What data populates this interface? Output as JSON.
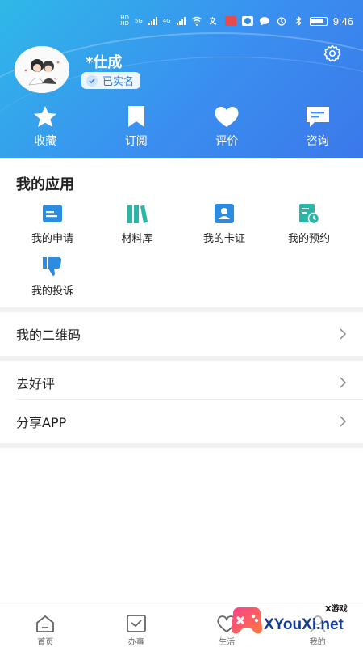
{
  "status_bar": {
    "network_labels": [
      "HD",
      "HD"
    ],
    "signal_1": "5G",
    "signal_2": "4G",
    "time": "9:46"
  },
  "profile": {
    "name": "*仕成",
    "verified_label": "已实名",
    "settings_icon": "gear-icon"
  },
  "quick_actions": [
    {
      "label": "收藏",
      "icon": "star-icon"
    },
    {
      "label": "订阅",
      "icon": "bookmark-icon"
    },
    {
      "label": "评价",
      "icon": "heart-icon"
    },
    {
      "label": "咨询",
      "icon": "chat-icon"
    }
  ],
  "my_apps": {
    "title": "我的应用",
    "items": [
      {
        "label": "我的申请",
        "icon": "application-card-icon"
      },
      {
        "label": "材料库",
        "icon": "books-icon"
      },
      {
        "label": "我的卡证",
        "icon": "id-card-icon"
      },
      {
        "label": "我的预约",
        "icon": "appointment-icon"
      },
      {
        "label": "我的投诉",
        "icon": "thumbs-down-icon"
      }
    ]
  },
  "menu": {
    "qr_code": "我的二维码",
    "good_review": "去好评",
    "share_app": "分享APP"
  },
  "tabs": [
    {
      "label": "首页",
      "icon": "home-icon"
    },
    {
      "label": "办事",
      "icon": "checkbox-icon"
    },
    {
      "label": "生活",
      "icon": "heart-outline-icon"
    },
    {
      "label": "我的",
      "icon": "user-icon"
    }
  ],
  "watermark": {
    "small": "X游戏",
    "main": "XYouXi.net"
  },
  "colors": {
    "header_start": "#2fb8e8",
    "header_end": "#3b78ea",
    "app_blue": "#2d8be0",
    "app_teal": "#2bb5a6",
    "divider": "#f0f0f0"
  }
}
